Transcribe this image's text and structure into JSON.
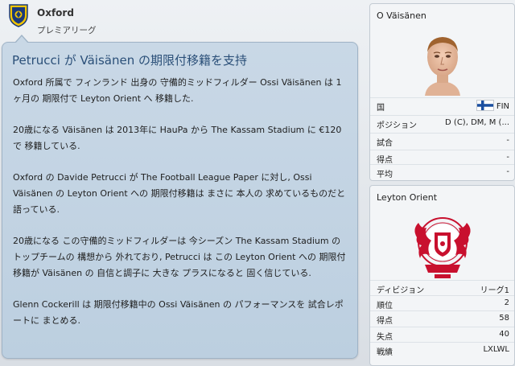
{
  "header": {
    "club_name": "Oxford",
    "league_name": "プレミアリーグ"
  },
  "article": {
    "headline": "Petrucci が Väisänen の期限付移籍を支持",
    "paragraphs": [
      "Oxford 所属で フィンランド 出身の 守備的ミッドフィルダー Ossi Väisänen は 1ヶ月の 期限付で Leyton Orient へ 移籍した.",
      "20歳になる Väisänen は 2013年に HauPa から The Kassam Stadium に €120 で 移籍している.",
      "Oxford の Davide Petrucci が The Football League Paper に対し, Ossi Väisänen の Leyton Orient への 期限付移籍は まさに 本人の 求めているものだと 語っている.",
      "20歳になる この守備的ミッドフィルダーは 今シーズン The Kassam Stadium の トップチームの 構想から 外れており, Petrucci は この Leyton Orient への 期限付移籍が Väisänen の 自信と調子に 大きな プラスになると 固く信じている.",
      "Glenn Cockerill は 期限付移籍中の Ossi Väisänen の パフォーマンスを 試合レポートに まとめる."
    ]
  },
  "player_panel": {
    "name": "O Väisänen",
    "rows": [
      {
        "label": "国",
        "value": "FIN",
        "flag": "finland-flag"
      },
      {
        "label": "ポジション",
        "value": "D (C), DM, M (..."
      },
      {
        "label": "試合",
        "value": "-"
      },
      {
        "label": "得点",
        "value": "-"
      },
      {
        "label": "平均",
        "value": "-"
      }
    ]
  },
  "team_panel": {
    "name": "Leyton Orient",
    "rows": [
      {
        "label": "ディビジョン",
        "value": "リーグ1"
      },
      {
        "label": "順位",
        "value": "2"
      },
      {
        "label": "得点",
        "value": "58"
      },
      {
        "label": "失点",
        "value": "40"
      },
      {
        "label": "戦績",
        "value": "LXLWL"
      }
    ]
  },
  "colors": {
    "headline": "#2a4f78",
    "bubble": "#c9d8e6",
    "crest_blue": "#1c3a7a",
    "crest_yellow": "#f2c500",
    "orient_red": "#c8102e"
  }
}
